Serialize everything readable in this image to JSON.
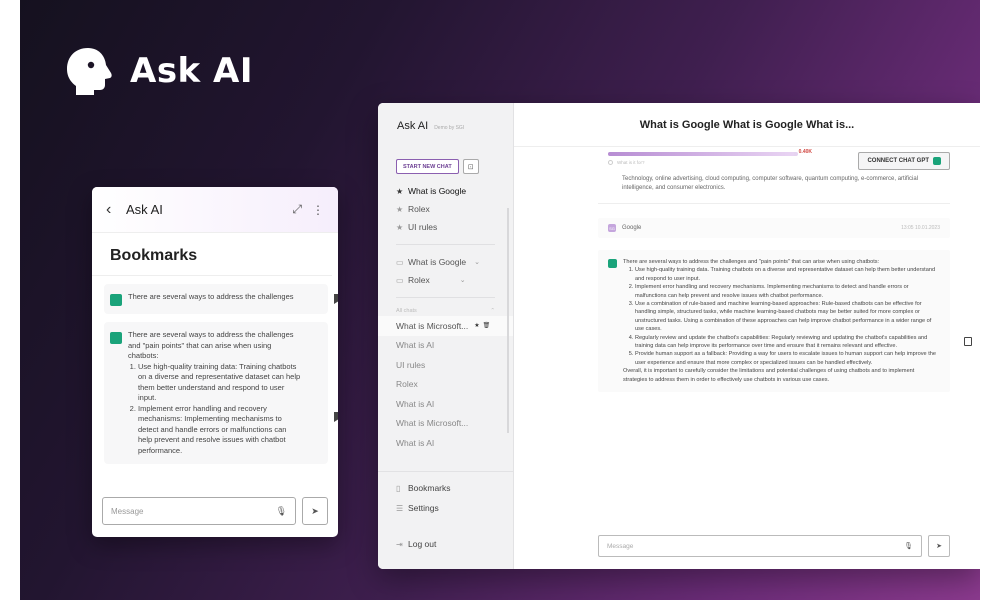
{
  "brand": {
    "name": "Ask AI"
  },
  "colors": {
    "accent": "#6c3f93",
    "gpt": "#1aa37a",
    "alert": "#d0453f"
  },
  "mobile": {
    "title": "Ask AI",
    "back_icon": "‹",
    "expand_icon": "⤢",
    "more_icon": "⋮",
    "page_title": "Bookmarks",
    "bookmarks": [
      {
        "text": "There are several ways to address the challenges"
      },
      {
        "intro": "There are several ways to address the challenges and \"pain points\" that can arise when using chatbots:",
        "points": [
          "Use high-quality training data: Training chatbots on a diverse and representative dataset can help them better understand and respond to user input.",
          "Implement error handling and recovery mechanisms: Implementing mechanisms to detect and handle errors or malfunctions can help prevent and resolve issues with chatbot performance."
        ]
      }
    ],
    "input_placeholder": "Message"
  },
  "desktop": {
    "sidebar": {
      "app_name": "Ask AI",
      "by_line": "Demo by SGI",
      "new_chat_label": "START NEW CHAT",
      "starred": [
        {
          "label": "What is Google",
          "active": true
        },
        {
          "label": "Rolex",
          "active": false
        },
        {
          "label": "UI rules",
          "active": false
        }
      ],
      "folders": [
        {
          "label": "What is Google"
        },
        {
          "label": "Rolex"
        }
      ],
      "section_label": "All chats",
      "chats": [
        {
          "label": "What is Microsoft..."
        },
        {
          "label": "What is AI"
        },
        {
          "label": "UI rules"
        },
        {
          "label": "Rolex"
        },
        {
          "label": "What is AI"
        },
        {
          "label": "What is Microsoft..."
        },
        {
          "label": "What is AI"
        }
      ],
      "bookmarks_label": "Bookmarks",
      "settings_label": "Settings",
      "logout_label": "Log out"
    },
    "main": {
      "title": "What is Google What is Google What is...",
      "progress_fraction": 0.98,
      "progress_meta": "What is it for?",
      "progress_alert": "0.40K",
      "connect_label": "CONNECT CHAT GPT",
      "answer_tail": "Technology, online advertising, cloud computing, computer software, quantum computing, e-commerce, artificial intelligence, and consumer electronics.",
      "question": {
        "avatar": "SG",
        "text": "Google",
        "timestamp": "13:05 10.01.2023"
      },
      "response": {
        "intro": "There are several ways to address the challenges and \"pain points\" that can arise when using chatbots:",
        "points": [
          "Use high-quality training data. Training chatbots on a diverse and representative dataset can help them better understand and respond to user input.",
          "Implement error handling and recovery mechanisms. Implementing mechanisms to detect and handle errors or malfunctions can help prevent and resolve issues with chatbot performance.",
          "Use a combination of rule-based and machine learning-based approaches: Rule-based chatbots can be effective for handling simple, structured tasks, while machine learning-based chatbots may be better suited for more complex or unstructured tasks. Using a combination of these approaches can help improve chatbot performance in a wider range of use cases.",
          "Regularly review and update the chatbot's capabilities: Regularly reviewing and updating the chatbot's capabilities and training data can help improve its performance over time and ensure that it remains relevant and effective.",
          "Provide human support as a fallback: Providing a way for users to escalate issues to human support can help improve the user experience and ensure that more complex or specialized issues can be handled effectively."
        ],
        "conclusion": "Overall, it is important to carefully consider the limitations and potential challenges of using chatbots and to implement strategies to address them in order to effectively use chatbots in various use cases."
      },
      "input_placeholder": "Message"
    }
  }
}
